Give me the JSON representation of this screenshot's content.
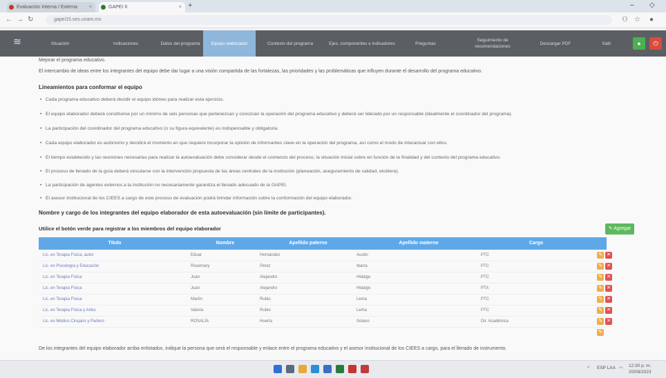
{
  "browser": {
    "tabs": [
      {
        "label": "Evaluación Interna / Externa"
      },
      {
        "label": "GAPEI II"
      }
    ],
    "url": "gapei15.ses.unam.mx"
  },
  "nav": {
    "items": [
      {
        "label": "Situación"
      },
      {
        "label": "Indicaciones"
      },
      {
        "label": "Datos del programa"
      },
      {
        "label": "Equipo elaborador"
      },
      {
        "label": "Contexto del programa"
      },
      {
        "label": "Ejes, componentes e indicadores"
      },
      {
        "label": "Preguntas"
      },
      {
        "label": "Seguimiento de recomendaciones"
      },
      {
        "label": "Descargar PDF"
      },
      {
        "label": "Salir"
      }
    ],
    "active_index": 3
  },
  "content": {
    "intro1": "Mejorar el programa educativo.",
    "intro2": "El intercambio de ideas entre los integrantes del equipo debe dar lugar a una visión compartida de las fortalezas, las prioridades y las problemáticas que influyen durante el desarrollo del programa educativo.",
    "guidelines_heading": "Lineamientos para conformar el equipo",
    "guidelines": [
      "Cada programa educativo deberá decidir el equipo idóneo para realizar esta ejercicio.",
      "El equipo elaborador deberá constituirse por un mínimo de seis personas que pertenezcan y conozcan la operación del programa educativo y deberá ser liderado por un responsable (idealmente el coordinador del programa).",
      "La participación del coordinador del programa educativo (o su figura equivalente) es indispensable y obligatoria.",
      "Cada equipo elaborador es autónomo y decidirá el momento en que requiere incorporar la opinión de informantes clave en la operación del programa, así como el modo de interactuar con ellos.",
      "El tiempo establecido y las reuniones necesarias para realizar la autoevaluación debe considerar desde el comienzo del proceso, la situación inicial sobre en función de la finalidad y del contexto del programa educativo.",
      "El proceso de llenado de la guía deberá vincularse con la intervención propuesta de las áreas centrales de la institución (planeación, aseguramiento de calidad, etcétera).",
      "La participación de agentes externos a la institución no necesariamente garantiza el llenado adecuado de la GAPEI.",
      "El asesor institucional de los CIEES a cargo de este proceso de evaluación podrá brindar información sobre la conformación del equipo elaborador."
    ],
    "members_heading": "Nombre y cargo de los integrantes del equipo elaborador de esta autoevaluación (sin límite de participantes).",
    "register_instruction": "Utilice el botón verde para registrar a los miembros del equipo elaborador",
    "add_button": "Agregar",
    "footer_text": "De los integrantes del equipo elaborador arriba enlistados, indique la persona que será el responsable y enlace entre el programa educativo y el asesor institucional de los CIEES a cargo, para el llenado de instrumento."
  },
  "table": {
    "headers": [
      "Título",
      "Nombre",
      "Apellido paterno",
      "Apellido materno",
      "Cargo"
    ],
    "rows": [
      [
        "Lic. en Terapia Física, autor",
        "Eduar",
        "Hernández",
        "Austin",
        "PTC"
      ],
      [
        "Lic. en Psicología y Educación",
        "Rosemary",
        "Pérez",
        "Ibarra",
        "PTC"
      ],
      [
        "Lic. en Terapia Física",
        "Juan",
        "Alejandro",
        "Hidalgo",
        "PTC"
      ],
      [
        "Lic. en Terapia Física",
        "Juan",
        "Alejandro",
        "Hidalgo",
        "PTA"
      ],
      [
        "Lic. en Terapia Física",
        "Martín",
        "Rubio",
        "Lema",
        "PTC"
      ],
      [
        "Lic. en Terapia Física y Artes",
        "Valeria",
        "Rubio",
        "Lema",
        "PTC"
      ],
      [
        "Lic. en Médico Cirujano y Partero",
        "ROSALÍA",
        "Huerta",
        "Solano",
        "Dir. Académica"
      ]
    ]
  },
  "taskbar": {
    "tray_lang": "ESP LAA",
    "tray_time": "12:30 p. m.",
    "tray_date": "20/09/2023"
  },
  "colors": {
    "nav_bg": "#5b5f63",
    "nav_active": "#8fb7dc",
    "table_header": "#5fa8e8",
    "add_button": "#5cb85c",
    "edit_button": "#f0ad4e",
    "delete_button": "#e05252"
  }
}
